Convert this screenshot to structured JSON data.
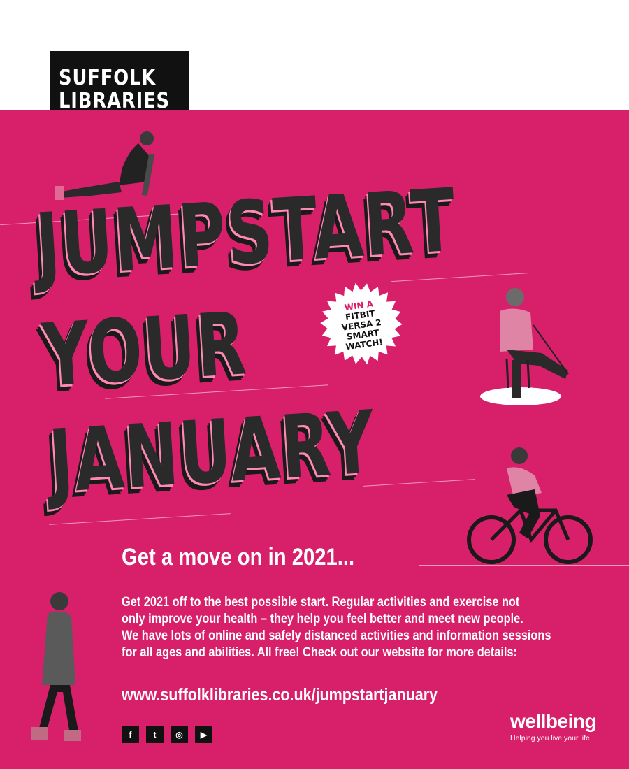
{
  "logo": {
    "line1": "SUFFOLK",
    "line2": "LIBRARIES"
  },
  "headline": {
    "line1": "JUMPSTART",
    "line2": "YOUR",
    "line3": "JANUARY"
  },
  "badge": {
    "win": "WIN A",
    "prize": "FITBIT\nVERSA 2\nSMART\nWATCH!"
  },
  "subheading": "Get a move on in 2021...",
  "body": {
    "lines": [
      "Get 2021 off to the best possible start. Regular activities and exercise not",
      "only improve your health – they help you feel better and meet new people.",
      "We have lots of online and safely distanced activities and information sessions",
      "for all ages and abilities. All free! Check out our website for more details:"
    ]
  },
  "url": "www.suffolklibraries.co.uk/jumpstartjanuary",
  "socials": [
    {
      "icon": "facebook-icon",
      "glyph": "f"
    },
    {
      "icon": "twitter-icon",
      "glyph": "t"
    },
    {
      "icon": "instagram-icon",
      "glyph": "◎"
    },
    {
      "icon": "youtube-icon",
      "glyph": "▶"
    }
  ],
  "wellbeing": {
    "word": "wellbeing",
    "tagline": "Helping you live your life"
  },
  "colors": {
    "brand_pink": "#d81f6a",
    "logo_black": "#111111",
    "text_white": "#ffffff"
  }
}
